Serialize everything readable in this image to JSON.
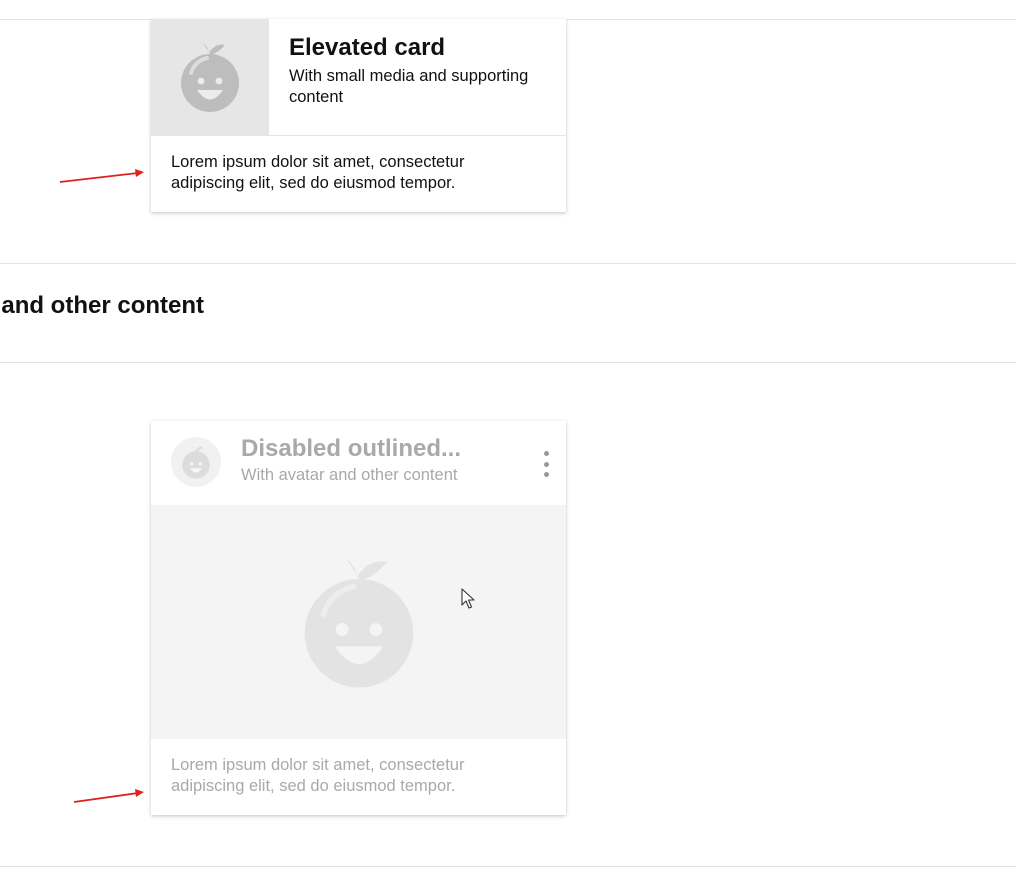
{
  "elevated_card": {
    "title": "Elevated card",
    "subtitle": "With small media and supporting content",
    "body": "Lorem ipsum dolor sit amet, consectetur adipiscing elit, sed do eiusmod tempor.",
    "media_icon": "fruit-mascot-icon"
  },
  "section": {
    "title": "tar and other content"
  },
  "disabled_card": {
    "title": "Disabled outlined...",
    "subtitle": "With avatar and other content",
    "body": "Lorem ipsum dolor sit amet, consectetur adipiscing elit, sed do eiusmod tempor.",
    "more_icon": "more-vertical-icon",
    "avatar_icon": "fruit-mascot-icon",
    "media_icon": "fruit-mascot-icon"
  },
  "colors": {
    "annotation_arrow": "#e02020",
    "disabled_text": "#a9a9a9",
    "media_background": "#f4f4f4"
  }
}
